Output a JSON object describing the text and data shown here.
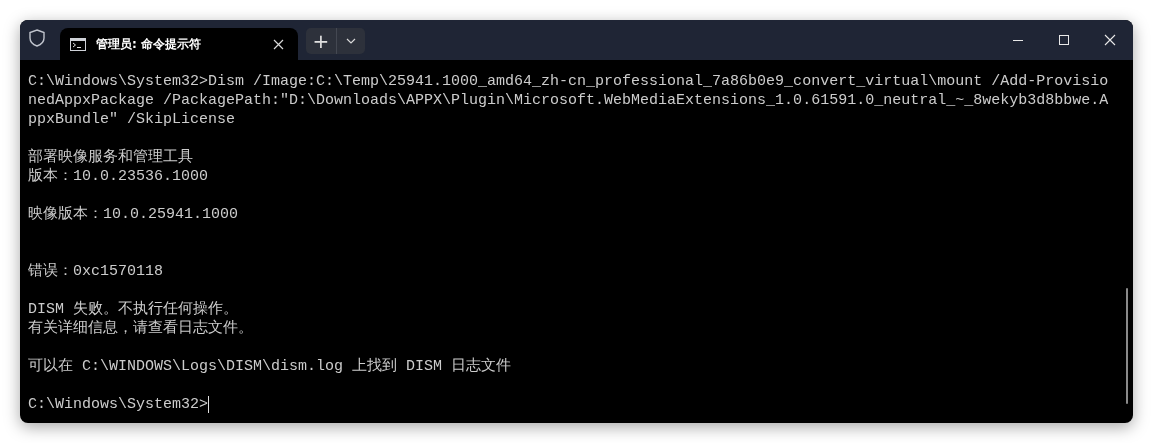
{
  "tab": {
    "title": "管理员: 命令提示符",
    "selected": true
  },
  "new_tab": {
    "label": "+"
  },
  "output": [
    {
      "kind": "text",
      "text": "C:\\Windows\\System32>Dism /Image:C:\\Temp\\25941.1000_amd64_zh-cn_professional_7a86b0e9_convert_virtual\\mount /Add-Provisio"
    },
    {
      "kind": "text",
      "text": "nedAppxPackage /PackagePath:\"D:\\Downloads\\APPX\\Plugin\\Microsoft.WebMediaExtensions_1.0.61591.0_neutral_~_8wekyb3d8bbwe.A"
    },
    {
      "kind": "text",
      "text": "ppxBundle\" /SkipLicense"
    },
    {
      "kind": "blank"
    },
    {
      "kind": "text",
      "text": "部署映像服务和管理工具"
    },
    {
      "kind": "text",
      "text": "版本：10.0.23536.1000"
    },
    {
      "kind": "blank"
    },
    {
      "kind": "text",
      "text": "映像版本：10.0.25941.1000"
    },
    {
      "kind": "blank"
    },
    {
      "kind": "blank"
    },
    {
      "kind": "text",
      "text": "错误：0xc1570118"
    },
    {
      "kind": "blank"
    },
    {
      "kind": "text",
      "text": "DISM 失败。不执行任何操作。"
    },
    {
      "kind": "text",
      "text": "有关详细信息，请查看日志文件。"
    },
    {
      "kind": "blank"
    },
    {
      "kind": "text",
      "text": "可以在 C:\\WINDOWS\\Logs\\DISM\\dism.log 上找到 DISM 日志文件"
    },
    {
      "kind": "blank"
    }
  ],
  "prompt": {
    "text": "C:\\Windows\\System32>",
    "cursor": true
  }
}
